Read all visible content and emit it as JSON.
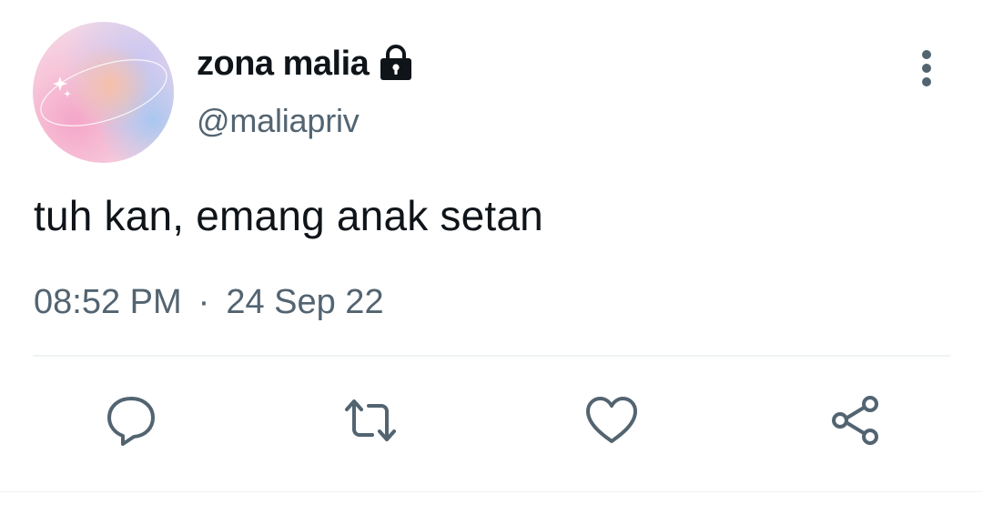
{
  "user": {
    "display_name": "zona malia",
    "handle": "@maliapriv",
    "protected_icon": "lock-icon",
    "avatar_icon": "pastel-gradient-avatar"
  },
  "tweet": {
    "text": "tuh kan, emang anak setan",
    "time": "08:52 PM",
    "separator": "·",
    "date": "24 Sep 22"
  },
  "actions": [
    {
      "name": "reply",
      "icon": "speech-bubble-icon"
    },
    {
      "name": "retweet",
      "icon": "retweet-icon"
    },
    {
      "name": "like",
      "icon": "heart-icon"
    },
    {
      "name": "share",
      "icon": "share-icon"
    }
  ],
  "menu": {
    "icon": "vertical-ellipsis-icon"
  },
  "colors": {
    "text_primary": "#0f1419",
    "text_secondary": "#536471",
    "divider": "#eff3f4",
    "icon": "#536471"
  }
}
